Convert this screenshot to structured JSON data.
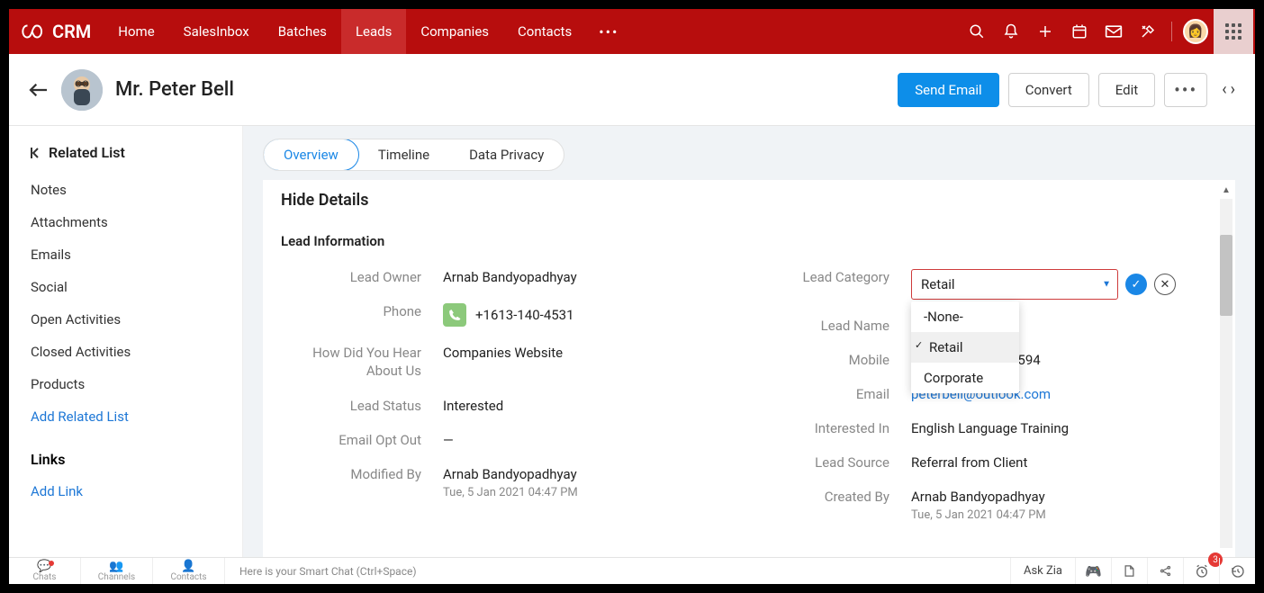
{
  "brand": "CRM",
  "nav": [
    "Home",
    "SalesInbox",
    "Batches",
    "Leads",
    "Companies",
    "Contacts"
  ],
  "nav_active_index": 3,
  "record": {
    "name": "Mr. Peter Bell",
    "actions": {
      "send_email": "Send Email",
      "convert": "Convert",
      "edit": "Edit"
    }
  },
  "sidebar": {
    "title": "Related List",
    "items": [
      "Notes",
      "Attachments",
      "Emails",
      "Social",
      "Open Activities",
      "Closed Activities",
      "Products"
    ],
    "add_related": "Add Related List",
    "links_title": "Links",
    "add_link": "Add Link"
  },
  "tabs": [
    "Overview",
    "Timeline",
    "Data Privacy"
  ],
  "details": {
    "hide": "Hide Details",
    "section": "Lead Information",
    "left": {
      "lead_owner": {
        "label": "Lead Owner",
        "value": "Arnab Bandyopadhyay"
      },
      "phone": {
        "label": "Phone",
        "value": "+1613-140-4531"
      },
      "hear": {
        "label": "How Did You Hear About Us",
        "value": "Companies Website"
      },
      "status": {
        "label": "Lead Status",
        "value": "Interested"
      },
      "optout": {
        "label": "Email Opt Out",
        "value": "—"
      },
      "modified": {
        "label": "Modified By",
        "value": "Arnab Bandyopadhyay",
        "sub": "Tue, 5 Jan 2021 04:47 PM"
      }
    },
    "right": {
      "category": {
        "label": "Lead Category",
        "value": "Retail",
        "options": [
          "-None-",
          "Retail",
          "Corporate"
        ]
      },
      "name": {
        "label": "Lead Name"
      },
      "mobile": {
        "label": "Mobile",
        "partial": "7594"
      },
      "email": {
        "label": "Email",
        "value": "peterbell@outlook.com"
      },
      "interested": {
        "label": "Interested In",
        "value": "English Language Training"
      },
      "source": {
        "label": "Lead Source",
        "value": "Referral from Client"
      },
      "created": {
        "label": "Created By",
        "value": "Arnab Bandyopadhyay",
        "sub": "Tue, 5 Jan 2021 04:47 PM"
      }
    }
  },
  "footer": {
    "tabs": [
      "Chats",
      "Channels",
      "Contacts"
    ],
    "smart_chat": "Here is your Smart Chat (Ctrl+Space)",
    "ask_zia": "Ask Zia",
    "badge": "3"
  }
}
